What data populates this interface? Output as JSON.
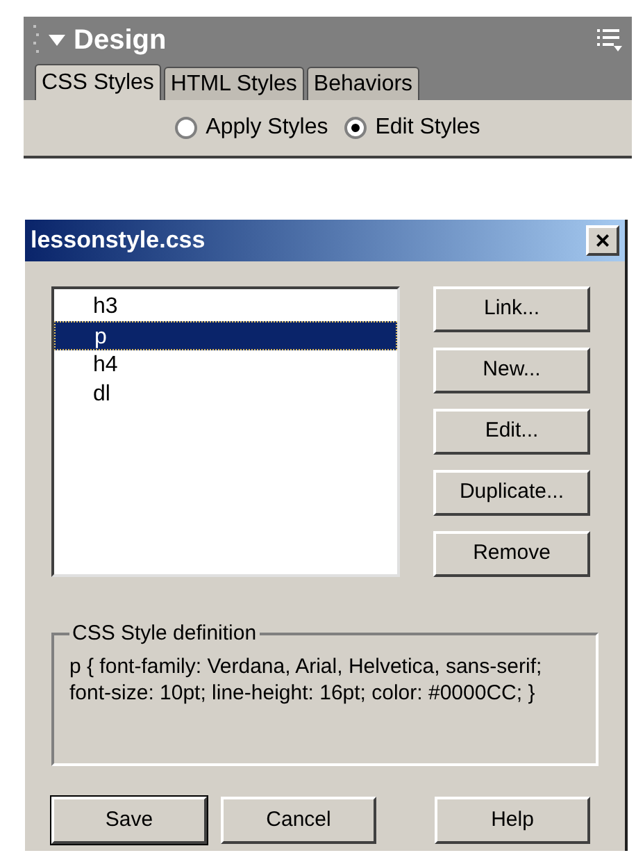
{
  "panel": {
    "title": "Design",
    "tabs": [
      {
        "label": "CSS Styles",
        "selected": true
      },
      {
        "label": "HTML Styles",
        "selected": false
      },
      {
        "label": "Behaviors",
        "selected": false
      }
    ],
    "radios": [
      {
        "label": "Apply Styles",
        "selected": false
      },
      {
        "label": "Edit Styles",
        "selected": true
      }
    ]
  },
  "dialog": {
    "title": "lessonstyle.css",
    "close": "×",
    "styles": [
      {
        "label": "h3",
        "selected": false
      },
      {
        "label": "p",
        "selected": true
      },
      {
        "label": "h4",
        "selected": false
      },
      {
        "label": "dl",
        "selected": false
      }
    ],
    "side_buttons": [
      "Link...",
      "New...",
      "Edit...",
      "Duplicate...",
      "Remove"
    ],
    "definition": {
      "legend": "CSS Style definition",
      "text": "p { font-family: Verdana, Arial, Helvetica, sans-serif; font-size: 10pt; line-height: 16pt; color: #0000CC; }"
    },
    "bottom_buttons": [
      {
        "label": "Save",
        "default": true
      },
      {
        "label": "Cancel",
        "default": false
      },
      {
        "label": "Help",
        "default": false
      }
    ]
  }
}
